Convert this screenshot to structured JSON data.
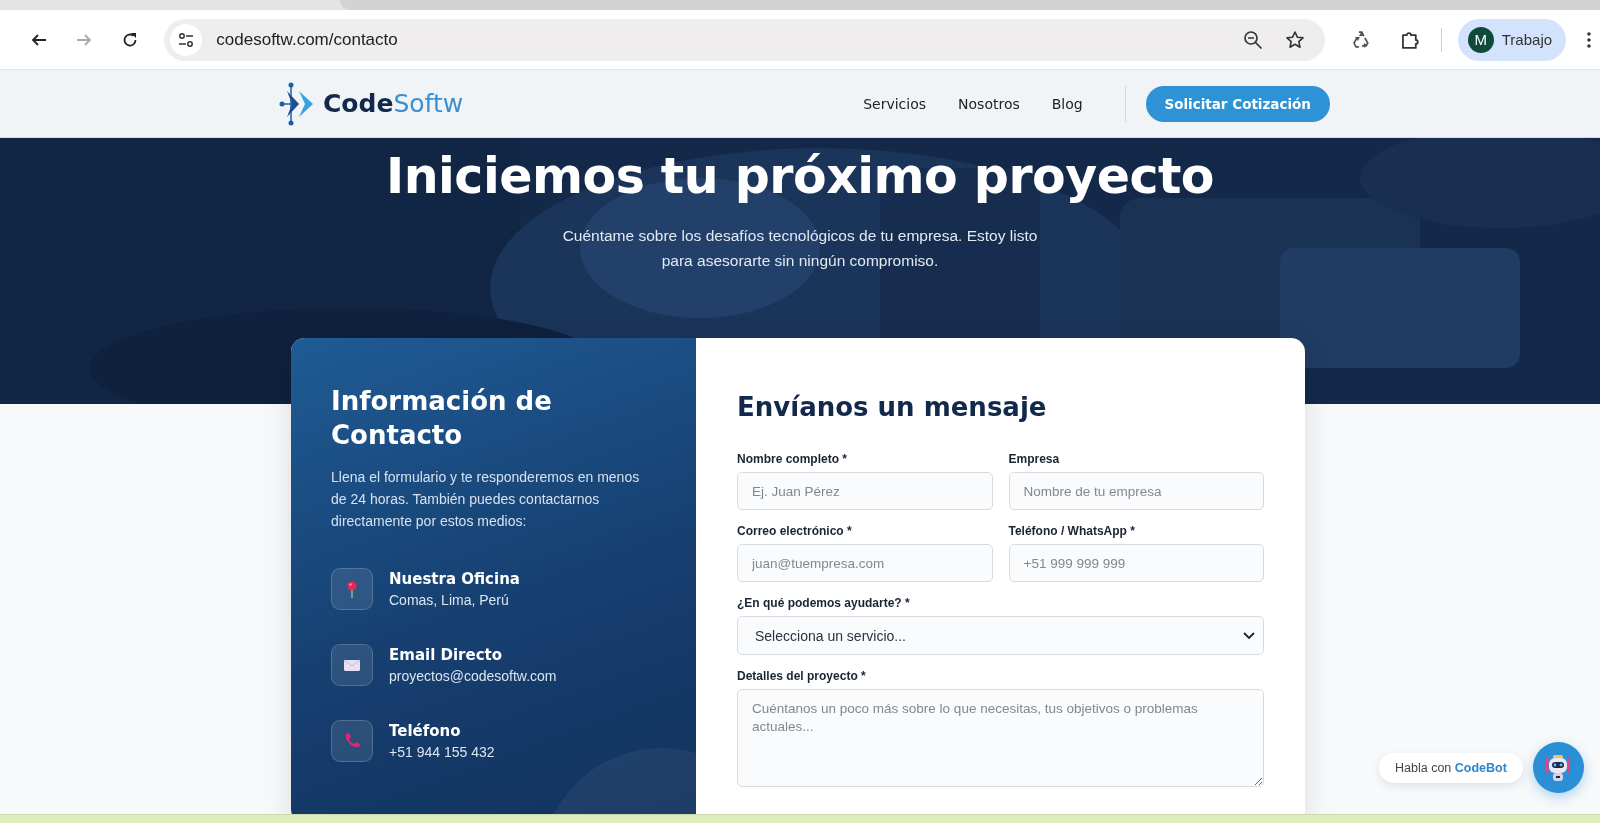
{
  "browser": {
    "nav_buttons": [
      {
        "kind": "back",
        "disabled": false
      },
      {
        "kind": "forward",
        "disabled": true
      },
      {
        "kind": "reload",
        "disabled": false
      }
    ],
    "url": "codesoftw.com/contacto",
    "profile": {
      "initial": "M",
      "name": "Trabajo"
    }
  },
  "site_header": {
    "logo": {
      "part_1": "Code",
      "part_2": "Softw"
    },
    "nav_links": [
      "Servicios",
      "Nosotros",
      "Blog"
    ],
    "cta": "Solicitar Cotización"
  },
  "hero": {
    "title": "Iniciemos tu próximo proyecto",
    "subtitle": "Cuéntame sobre los desafíos tecnológicos de tu empresa. Estoy listo para asesorarte sin ningún compromiso."
  },
  "contact_info": {
    "title": "Información de Contacto",
    "text": "Llena el formulario y te responderemos en menos de 24 horas. También puedes contactarnos directamente por estos medios:",
    "items": [
      {
        "kind": "location",
        "title": "Nuestra Oficina",
        "value": "Comas, Lima, Perú"
      },
      {
        "kind": "email",
        "title": "Email Directo",
        "value": "proyectos@codesoftw.com"
      },
      {
        "kind": "phone",
        "title": "Teléfono",
        "value": "+51 944 155 432"
      }
    ]
  },
  "form": {
    "title": "Envíanos un mensaje",
    "fields": [
      {
        "kind": "input",
        "label": "Nombre completo *",
        "placeholder": "Ej. Juan Pérez"
      },
      {
        "kind": "input",
        "label": "Empresa",
        "placeholder": "Nombre de tu empresa"
      },
      {
        "kind": "input",
        "label": "Correo electrónico *",
        "placeholder": "juan@tuempresa.com"
      },
      {
        "kind": "input",
        "label": "Teléfono / WhatsApp *",
        "placeholder": "+51 999 999 999"
      },
      {
        "kind": "select",
        "label": "¿En qué podemos ayudarte? *",
        "value": "Selecciona un servicio..."
      },
      {
        "kind": "textarea",
        "label": "Detalles del proyecto *",
        "placeholder": "Cuéntanos un poco más sobre lo que necesitas, tus objetivos o problemas actuales..."
      }
    ]
  },
  "chat": {
    "text": "Habla con **CodeBot**"
  }
}
